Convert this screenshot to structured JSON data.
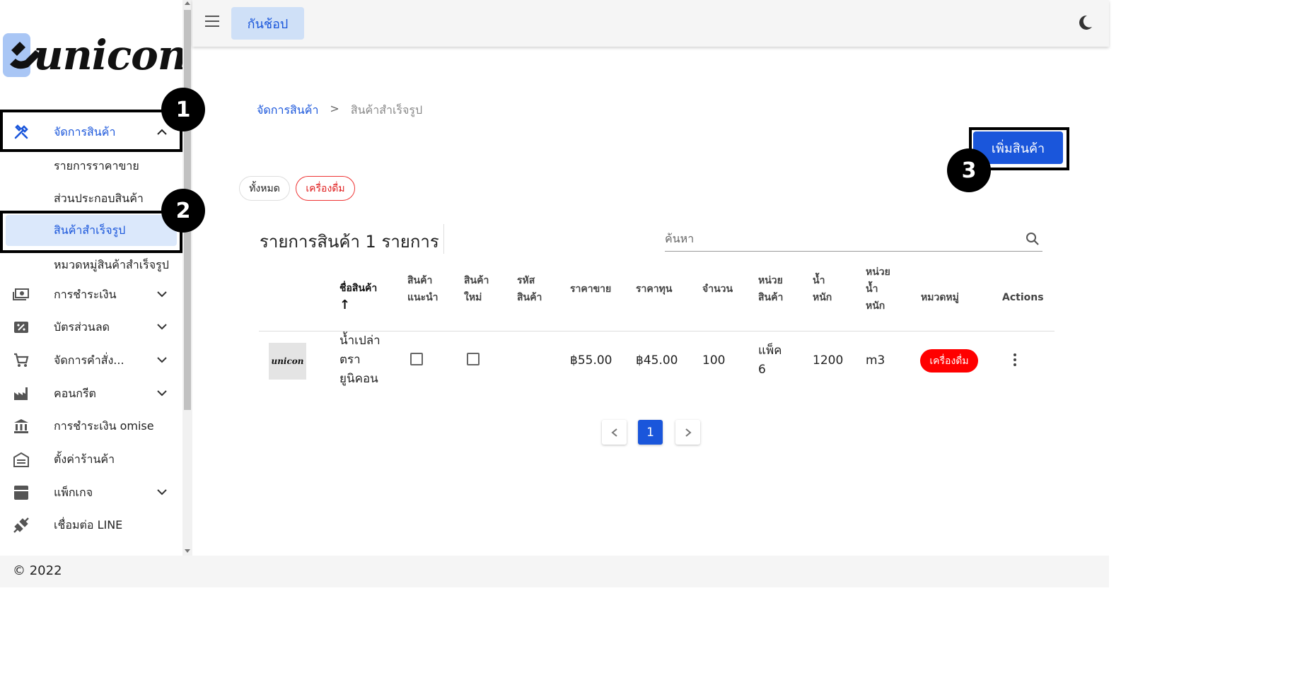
{
  "app": {
    "brand": "unicon",
    "store_name": "กันช้อป"
  },
  "sidebar": {
    "items": [
      {
        "label": "จัดการสินค้า",
        "icon": "tools-icon",
        "expanded": true
      },
      {
        "label": "การชำระเงิน",
        "icon": "cash-icon"
      },
      {
        "label": "บัตรส่วนลด",
        "icon": "coupon-icon"
      },
      {
        "label": "จัดการคำสั่ง...",
        "icon": "cart-icon"
      },
      {
        "label": "คอนกรีต",
        "icon": "factory-icon"
      },
      {
        "label": "การชำระเงิน omise",
        "icon": "bank-icon"
      },
      {
        "label": "ตั้งค่าร้านค้า",
        "icon": "store-icon"
      },
      {
        "label": "แพ็กเกจ",
        "icon": "package-icon"
      },
      {
        "label": "เชื่อมต่อ LINE",
        "icon": "plug-icon"
      }
    ],
    "subitems": [
      {
        "label": "รายการราคาขาย"
      },
      {
        "label": "ส่วนประกอบสินค้า"
      },
      {
        "label": "สินค้าสำเร็จรูป",
        "selected": true
      },
      {
        "label": "หมวดหมู่สินค้าสำเร็จรูป"
      }
    ]
  },
  "annotations": {
    "one": "1",
    "two": "2",
    "three": "3"
  },
  "breadcrumb": {
    "parent": "จัดการสินค้า",
    "separator": ">",
    "current": "สินค้าสำเร็จรูป"
  },
  "actions": {
    "add_product": "เพิ่มสินค้า"
  },
  "filters": {
    "all": "ทั้งหมด",
    "drink": "เครื่องดื่ม"
  },
  "list": {
    "title": "รายการสินค้า 1 รายการ",
    "search_placeholder": "ค้นหา"
  },
  "table": {
    "headers": {
      "name": "ชื่อสินค้า",
      "sort_arrow": "↑",
      "recommended": [
        "สินค้า",
        "แนะนำ"
      ],
      "new": [
        "สินค้า",
        "ใหม่"
      ],
      "code": [
        "รหัส",
        "สินค้า"
      ],
      "price": "ราคาขาย",
      "cost": "ราคาทุน",
      "qty": "จำนวน",
      "unit": [
        "หน่วย",
        "สินค้า"
      ],
      "weight": [
        "น้ำ",
        "หนัก"
      ],
      "weight_unit": [
        "หน่วย",
        "น้ำ",
        "หนัก"
      ],
      "category": "หมวดหมู่",
      "actions": "Actions"
    },
    "rows": [
      {
        "thumb_text": "unicon",
        "name": [
          "น้ำเปล่า",
          "ตรา",
          "ยูนิคอน"
        ],
        "recommended": false,
        "new": false,
        "code": "",
        "price": "฿55.00",
        "cost": "฿45.00",
        "qty": "100",
        "unit": [
          "แพ็ค",
          "6"
        ],
        "weight": "1200",
        "weight_unit": "m3",
        "category": "เครื่องดื่ม"
      }
    ]
  },
  "pagination": {
    "current": "1"
  },
  "footer": {
    "copyright": "© 2022"
  },
  "colors": {
    "primary": "#1a56db",
    "danger": "#ff0000",
    "highlight": "#dbe8fb"
  }
}
